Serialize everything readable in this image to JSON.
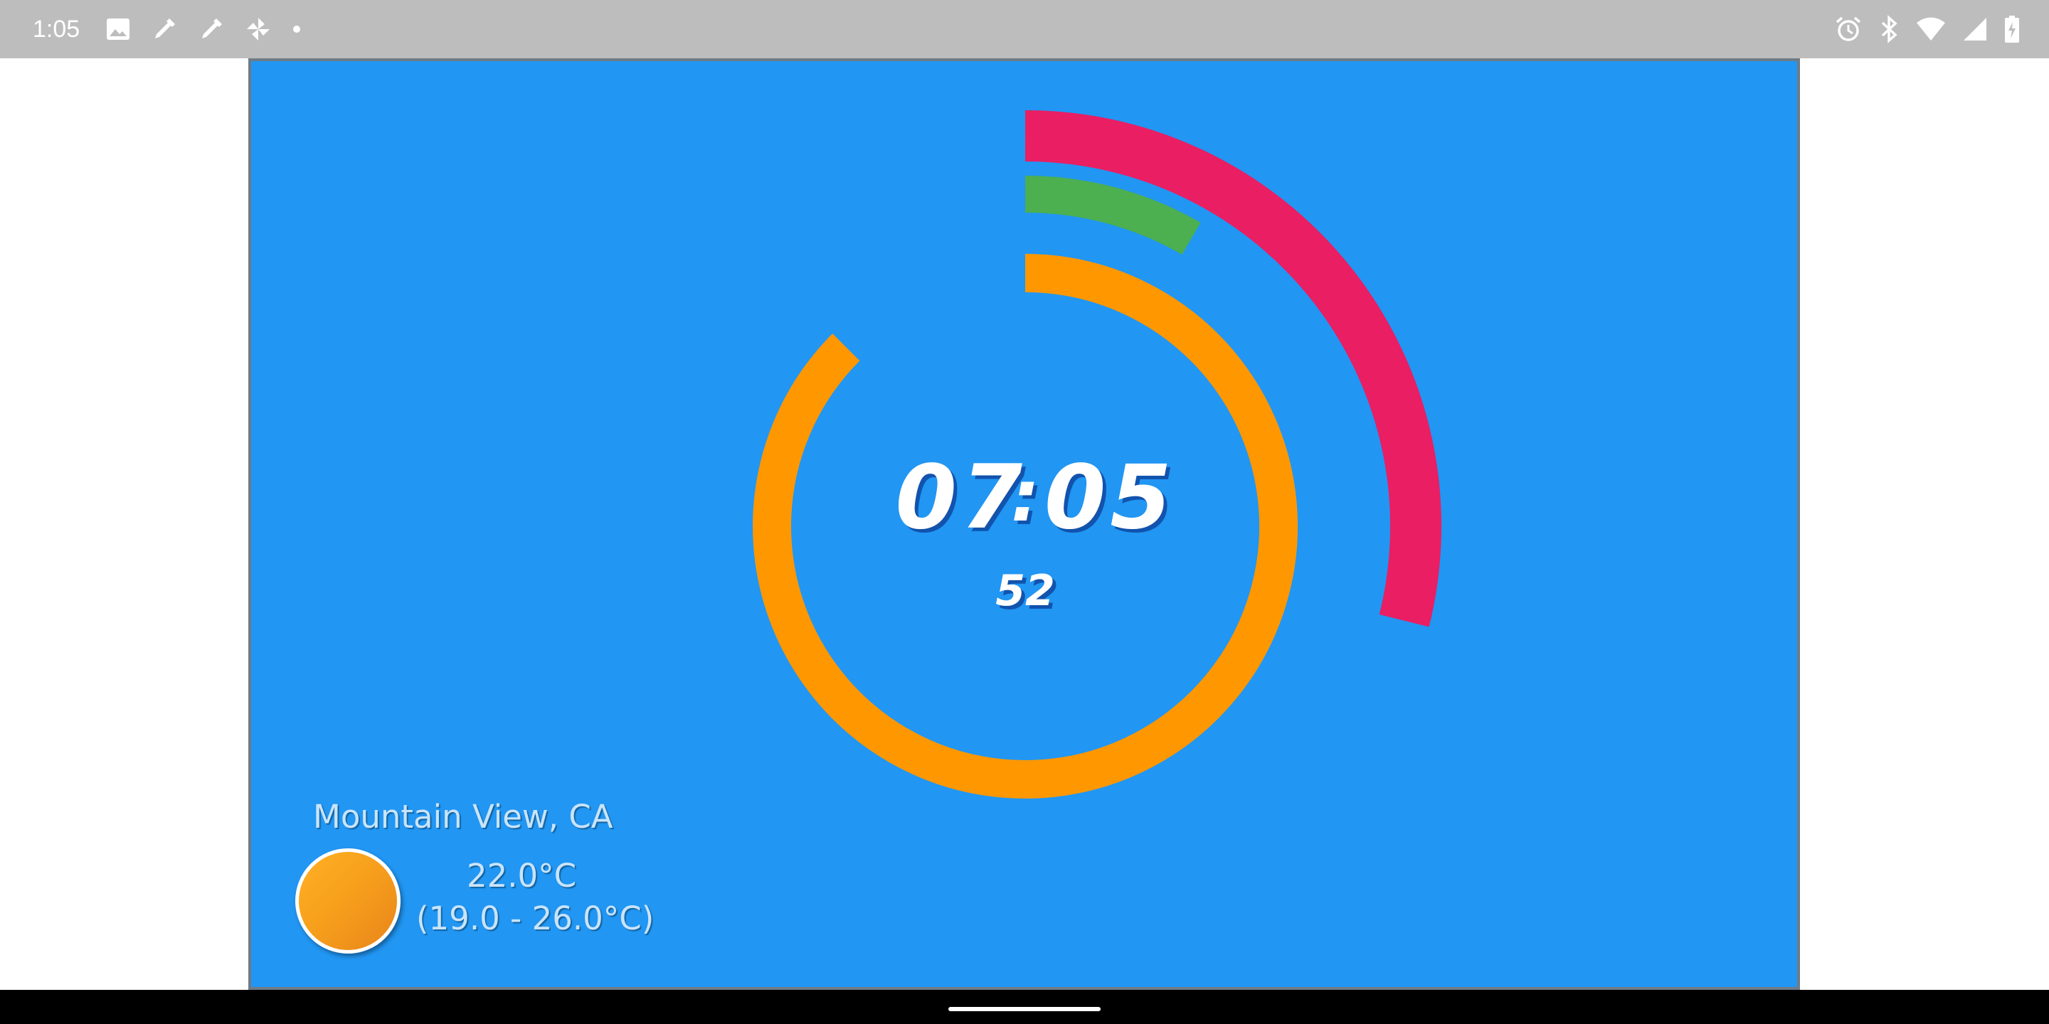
{
  "status_bar": {
    "time": "1:05",
    "left_icons": [
      "image-icon",
      "dropper-icon",
      "dropper-icon",
      "pinwheel-icon",
      "dot-icon"
    ],
    "right_icons": [
      "alarm-icon",
      "bluetooth-icon",
      "wifi-icon",
      "signal-icon",
      "battery-charging-icon"
    ]
  },
  "clock": {
    "hours": "07",
    "separator": ":",
    "minutes": "05",
    "seconds": "52",
    "rings": {
      "hours": {
        "color": "#ff9800",
        "progress": 0.875
      },
      "minutes": {
        "color": "#4caf50",
        "progress": 0.0833
      },
      "seconds": {
        "color": "#e91e63",
        "progress": 0.2889
      }
    },
    "background_color": "#2196f3"
  },
  "weather": {
    "location": "Mountain View, CA",
    "current_temp": "22.0°C",
    "range": "(19.0 - 26.0°C)",
    "icon": "sun-icon"
  }
}
